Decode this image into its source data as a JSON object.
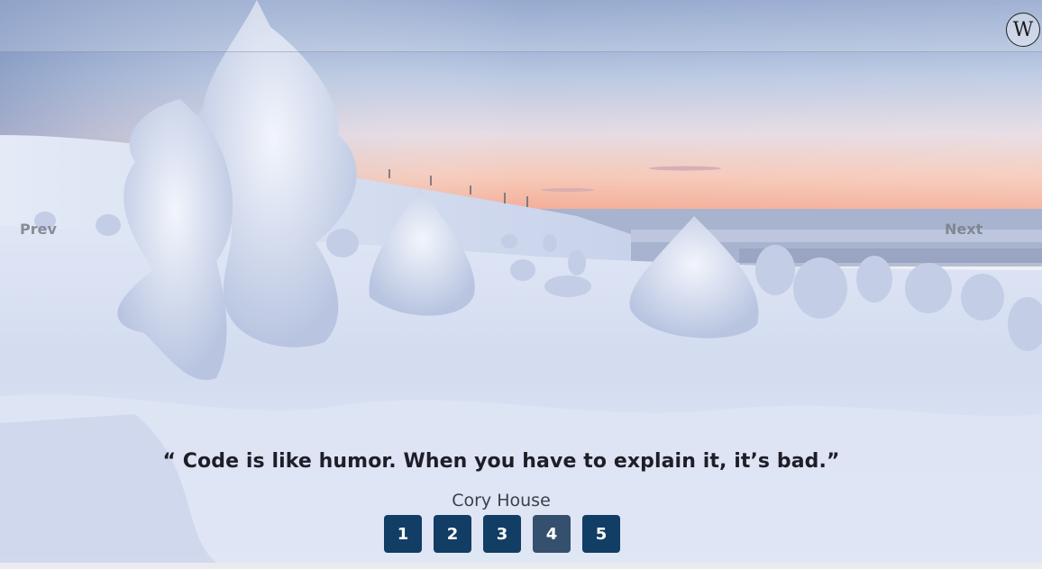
{
  "header": {
    "logo_letter": "W",
    "logo_icon": "w-logo-icon"
  },
  "navigation": {
    "prev_label": "Prev",
    "next_label": "Next"
  },
  "slide": {
    "quote": "“ Code is like humor. When you have to explain it, it’s bad.”",
    "author": "Cory House"
  },
  "pagination": {
    "pages": [
      "1",
      "2",
      "3",
      "4",
      "5"
    ],
    "active_index": 3,
    "colors": {
      "button": "#123d64",
      "active_button": "#34506e"
    }
  }
}
